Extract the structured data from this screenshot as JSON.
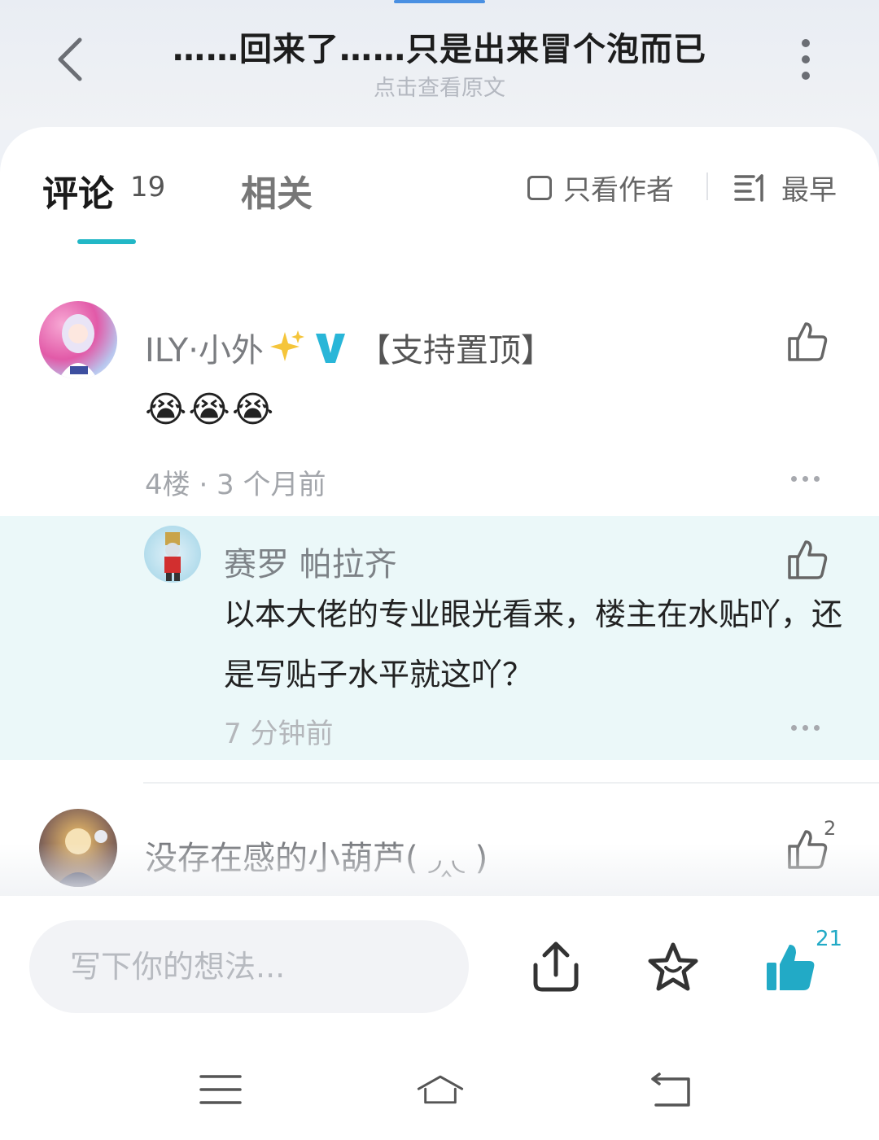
{
  "header": {
    "title": "……回来了……只是出来冒个泡而已",
    "subtitle": "点击查看原文"
  },
  "tabs": {
    "comments_label": "评论",
    "comments_count": "19",
    "related_label": "相关",
    "only_author": "只看作者",
    "sort_label": "最早"
  },
  "comments": [
    {
      "username": "ILY·小外",
      "tag": "【支持置顶】",
      "content_emoji": "😭😭😭",
      "meta": "4楼 · 3 个月前",
      "reply": {
        "username": "赛罗 帕拉齐",
        "content": "以本大佬的专业眼光看来，楼主在水贴吖，还是写贴子水平就这吖？",
        "time": "7 分钟前"
      }
    },
    {
      "username": "没存在感的小葫芦( ◞‸◟ )",
      "likes": "2"
    }
  ],
  "bottom": {
    "input_placeholder": "写下你的想法...",
    "like_count": "21"
  },
  "colors": {
    "accent": "#22b7c6",
    "like_active": "#22aac6",
    "reply_bg": "#ebf8f9"
  }
}
